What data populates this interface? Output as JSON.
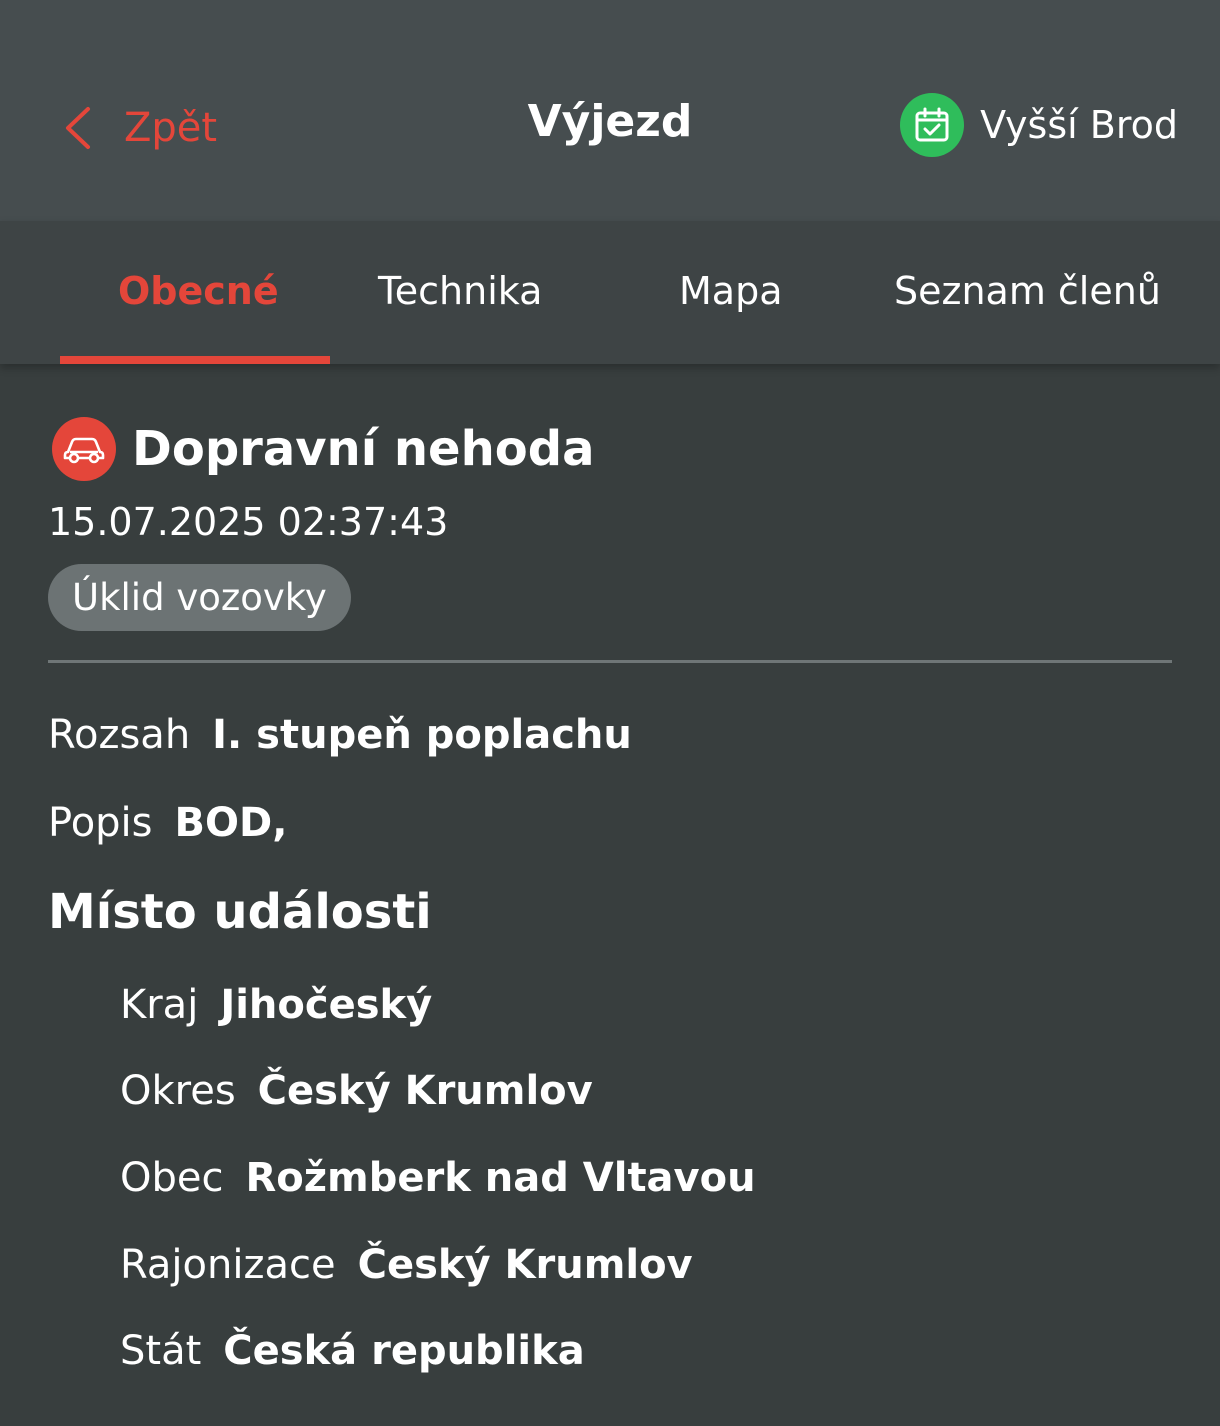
{
  "header": {
    "back_label": "Zpět",
    "title": "Výjezd",
    "station_label": "Vyšší Brod",
    "back_icon": "chevron-left-icon",
    "station_icon": "calendar-check-icon"
  },
  "tabs": [
    {
      "label": "Obecné",
      "active": true
    },
    {
      "label": "Technika",
      "active": false
    },
    {
      "label": "Mapa",
      "active": false
    },
    {
      "label": "Seznam členů",
      "active": false
    }
  ],
  "event": {
    "icon": "car-icon",
    "title": "Dopravní nehoda",
    "datetime": "15.07.2025 02:37:43",
    "tag": "Úklid vozovky"
  },
  "details": {
    "rozsah": {
      "label": "Rozsah",
      "value": "I. stupeň poplachu"
    },
    "popis": {
      "label": "Popis",
      "value": "BOD,"
    }
  },
  "location": {
    "section_title": "Místo události",
    "fields": [
      {
        "label": "Kraj",
        "value": "Jihočeský"
      },
      {
        "label": "Okres",
        "value": "Český Krumlov"
      },
      {
        "label": "Obec",
        "value": "Rožmberk nad Vltavou"
      },
      {
        "label": "Rajonizace",
        "value": "Český Krumlov"
      },
      {
        "label": "Stát",
        "value": "Česká republika"
      }
    ]
  },
  "colors": {
    "accent": "#e4463a",
    "header_bg": "#464d4f",
    "content_bg": "#383e3e",
    "station_green": "#2fbd5b"
  }
}
